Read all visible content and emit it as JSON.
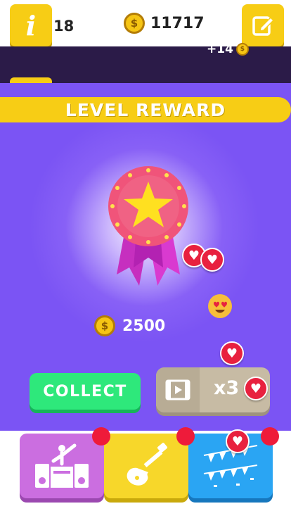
{
  "header": {
    "level": "18",
    "coin_total": "11717",
    "info_icon_glyph": "i"
  },
  "background_strip": {
    "plus_coins": "+14"
  },
  "reward_panel": {
    "title": "LEVEL REWARD",
    "reward_amount": "2500",
    "collect_label": "COLLECT",
    "multiplier_label": "x3"
  },
  "categories": [
    {
      "name": "dj-category",
      "icon": "dj-booth-icon",
      "color": "#cb6ee0"
    },
    {
      "name": "rock-category",
      "icon": "electric-guitar-icon",
      "color": "#f7d72a"
    },
    {
      "name": "party-category",
      "icon": "party-confetti-icon",
      "color": "#2aa5f3"
    }
  ],
  "colors": {
    "panel": "#7b54f4",
    "accent_yellow": "#f7cd15",
    "collect_green": "#2ee87b",
    "heart_red": "#e8213f"
  },
  "icons": {
    "coin": "dollar-coin-icon",
    "heart": "heart-icon",
    "video": "video-ad-icon",
    "edit": "edit-pencil-icon",
    "medal": "star-medal-icon",
    "emoji": "heart-eyes-emoji-icon"
  }
}
